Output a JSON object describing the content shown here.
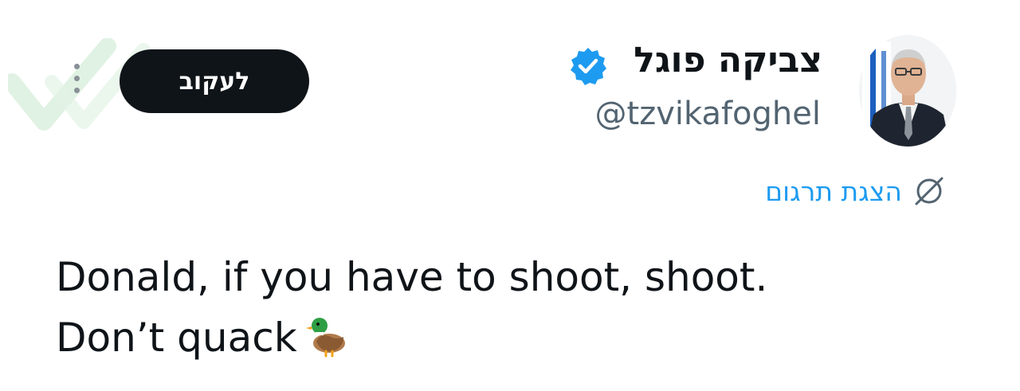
{
  "header": {
    "follow_label": "לעקוב",
    "display_name": "צביקה פוגל",
    "handle": "@tzvikafoghel",
    "verified": true,
    "avatar_icon": "profile-photo-with-israeli-flag"
  },
  "translate": {
    "label": "הצגת תרגום",
    "icon": "globe-slash-icon"
  },
  "tweet": {
    "line1": "Donald, if you have to shoot, shoot.",
    "line2": "Don’t quack",
    "emoji": "duck"
  },
  "colors": {
    "link": "#1d9bf0",
    "verified": "#1d9bf0",
    "button_bg": "#0f1419",
    "muted": "#536471"
  }
}
